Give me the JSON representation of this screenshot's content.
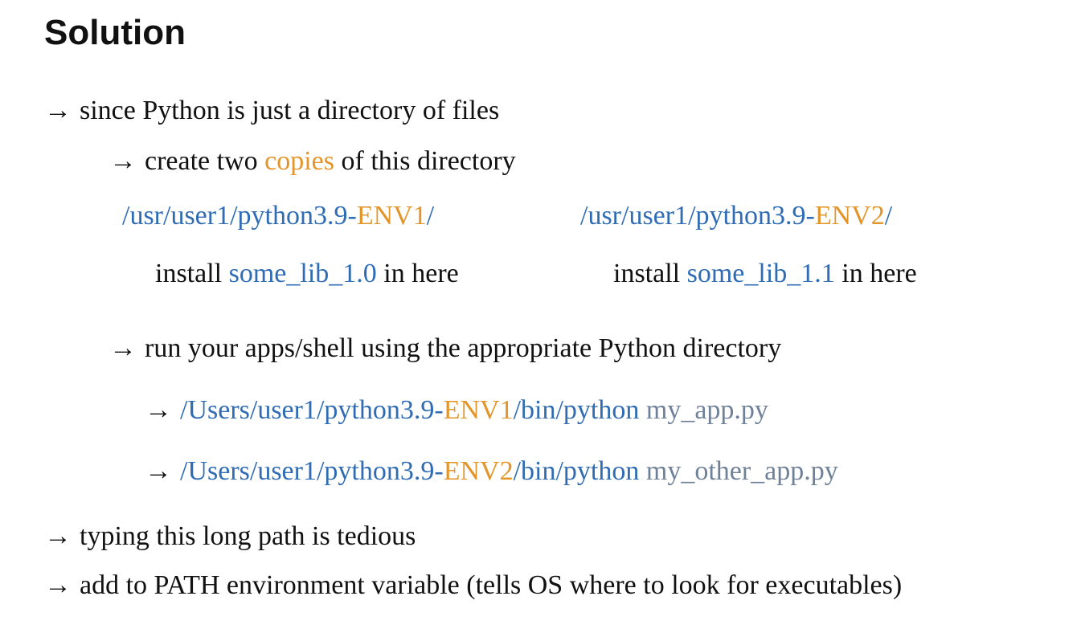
{
  "title": "Solution",
  "arrow": "→",
  "line1": "since Python is just a directory of files",
  "line2": {
    "before": "create two ",
    "highlight": "copies",
    "after": " of this directory"
  },
  "env1_path": {
    "prefix": "/usr/user1/python3.9-",
    "env": "ENV1",
    "suffix": "/"
  },
  "env2_path": {
    "prefix": "/usr/user1/python3.9-",
    "env": "ENV2",
    "suffix": "/"
  },
  "install1": {
    "before": "install ",
    "lib": "some_lib_1.0",
    "after": " in here"
  },
  "install2": {
    "before": "install ",
    "lib": "some_lib_1.1",
    "after": " in here"
  },
  "line3": "run your apps/shell using the appropriate Python directory",
  "cmd1": {
    "prefix": "/Users/user1/python3.9-",
    "env": "ENV1",
    "suffix": "/bin/python",
    "script": " my_app.py"
  },
  "cmd2": {
    "prefix": "/Users/user1/python3.9-",
    "env": "ENV2",
    "suffix": "/bin/python",
    "script": " my_other_app.py"
  },
  "line4": "typing this long path is tedious",
  "line5": "add to PATH environment variable (tells OS where to look for executables)",
  "colors": {
    "path_blue": "#2f6cb3",
    "env_orange": "#e3952a",
    "script_gray": "#6f8198",
    "text": "#111111"
  }
}
